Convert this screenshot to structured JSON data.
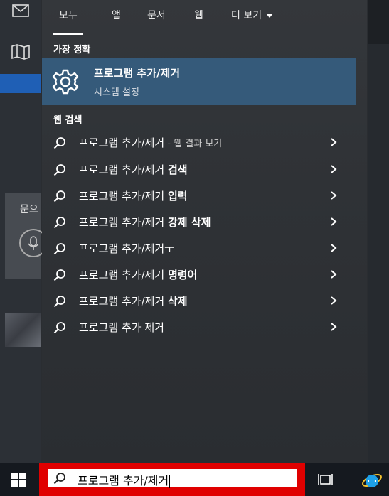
{
  "tabs": [
    {
      "label": "모두",
      "active": true
    },
    {
      "label": "앱"
    },
    {
      "label": "문서"
    },
    {
      "label": "웹"
    },
    {
      "label": "더 보기"
    }
  ],
  "best_match": {
    "section_label": "가장 정확",
    "title": "프로그램 추가/제거",
    "subtitle": "시스템 설정",
    "icon": "gear-icon"
  },
  "web_search": {
    "section_label": "웹 검색",
    "results": [
      {
        "text": "프로그램 추가/제거",
        "bold": "",
        "suffix": " - 웹 결과 보기"
      },
      {
        "text": "프로그램 추가/제거 ",
        "bold": "검색",
        "suffix": ""
      },
      {
        "text": "프로그램 추가/제거 ",
        "bold": "입력",
        "suffix": ""
      },
      {
        "text": "프로그램 추가/제거 ",
        "bold": "강제 삭제",
        "suffix": ""
      },
      {
        "text": "프로그램 추가/제거",
        "bold": "ㅜ",
        "suffix": ""
      },
      {
        "text": "프로그램 추가/제거 ",
        "bold": "명령어",
        "suffix": ""
      },
      {
        "text": "프로그램 추가/제거 ",
        "bold": "삭제",
        "suffix": ""
      },
      {
        "text": "프로그램 추가 제거",
        "bold": "",
        "suffix": ""
      }
    ]
  },
  "left_panel": {
    "card_text": "문으"
  },
  "taskbar": {
    "search_value": "프로그램 추가/제거"
  },
  "colors": {
    "accent_highlight": "#355a7a",
    "search_frame": "#e00000",
    "taskbar": "#15191f"
  }
}
